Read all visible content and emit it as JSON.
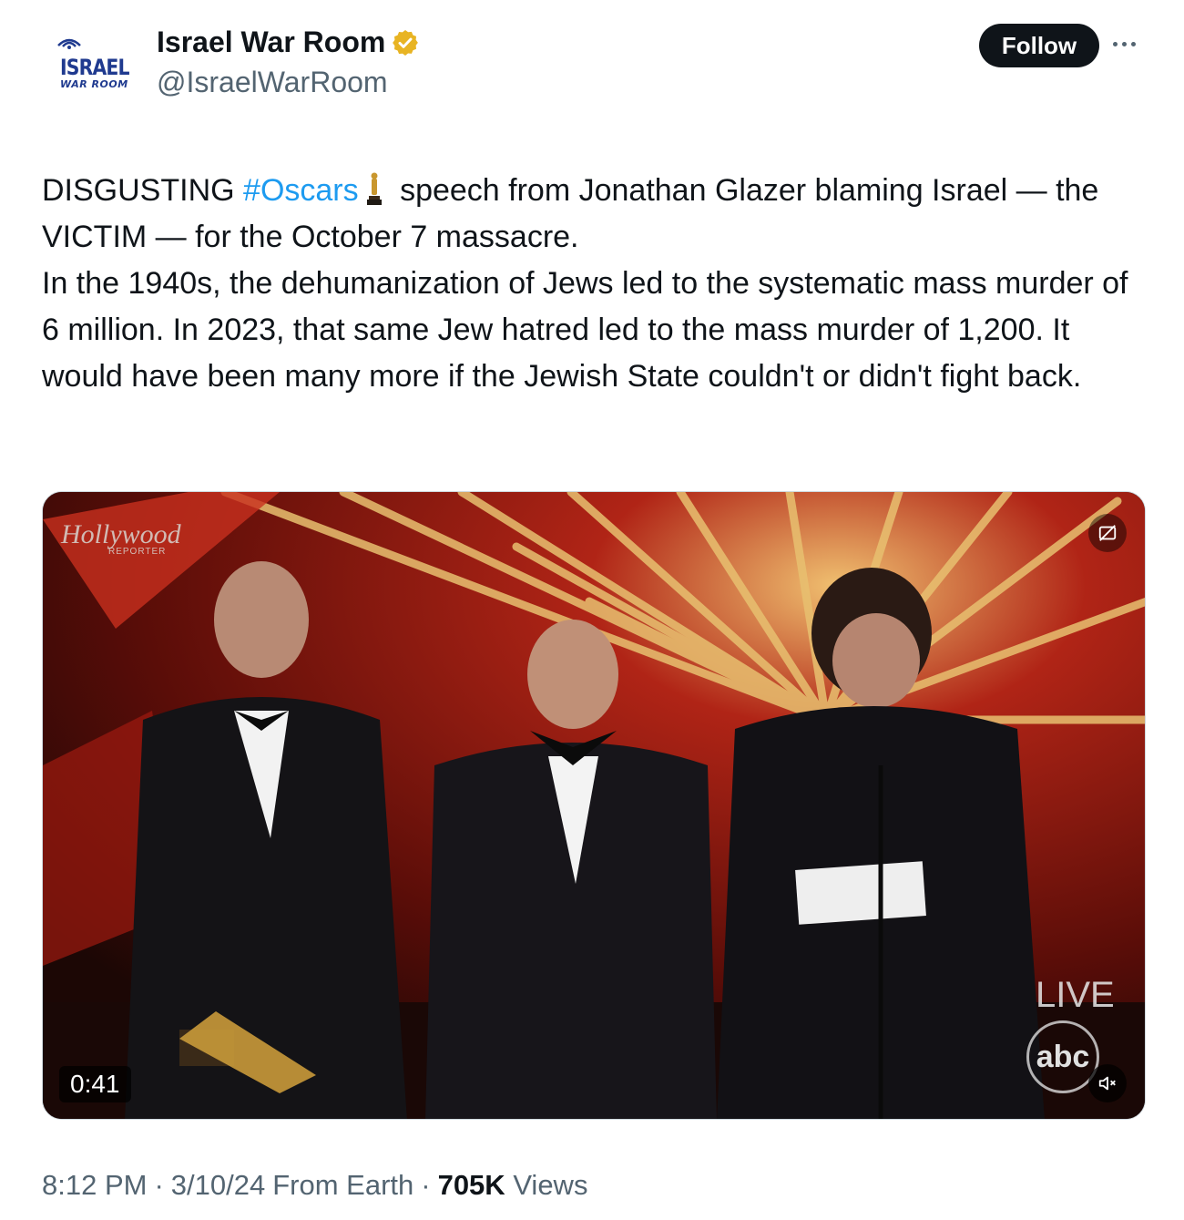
{
  "account": {
    "display_name": "Israel War Room",
    "handle": "@IsraelWarRoom",
    "avatar_logo_main": "ISRAEL",
    "avatar_logo_sub": "WAR ROOM",
    "verified_color": "#E8B423"
  },
  "actions": {
    "follow_label": "Follow"
  },
  "tweet": {
    "segments": {
      "part1": "DISGUSTING ",
      "hashtag": "#Oscars",
      "part2": " speech from Jonathan Glazer blaming Israel — the VICTIM — for the October 7 massacre.",
      "line3": "In the 1940s, the dehumanization of Jews led to the systematic mass murder of 6 million. In 2023, that same Jew hatred led to the mass murder of 1,200. It would have been many more if the Jewish State couldn't or didn't fight back."
    },
    "hashtag_color": "#1D9BF0"
  },
  "media": {
    "watermark": "Hollywood",
    "watermark_sub": "REPORTER",
    "live_label": "LIVE",
    "network_logo": "abc",
    "duration": "0:41"
  },
  "meta": {
    "time": "8:12 PM",
    "date": "3/10/24",
    "source": "From Earth",
    "views_count": "705K",
    "views_label": "Views",
    "separator": "·"
  }
}
